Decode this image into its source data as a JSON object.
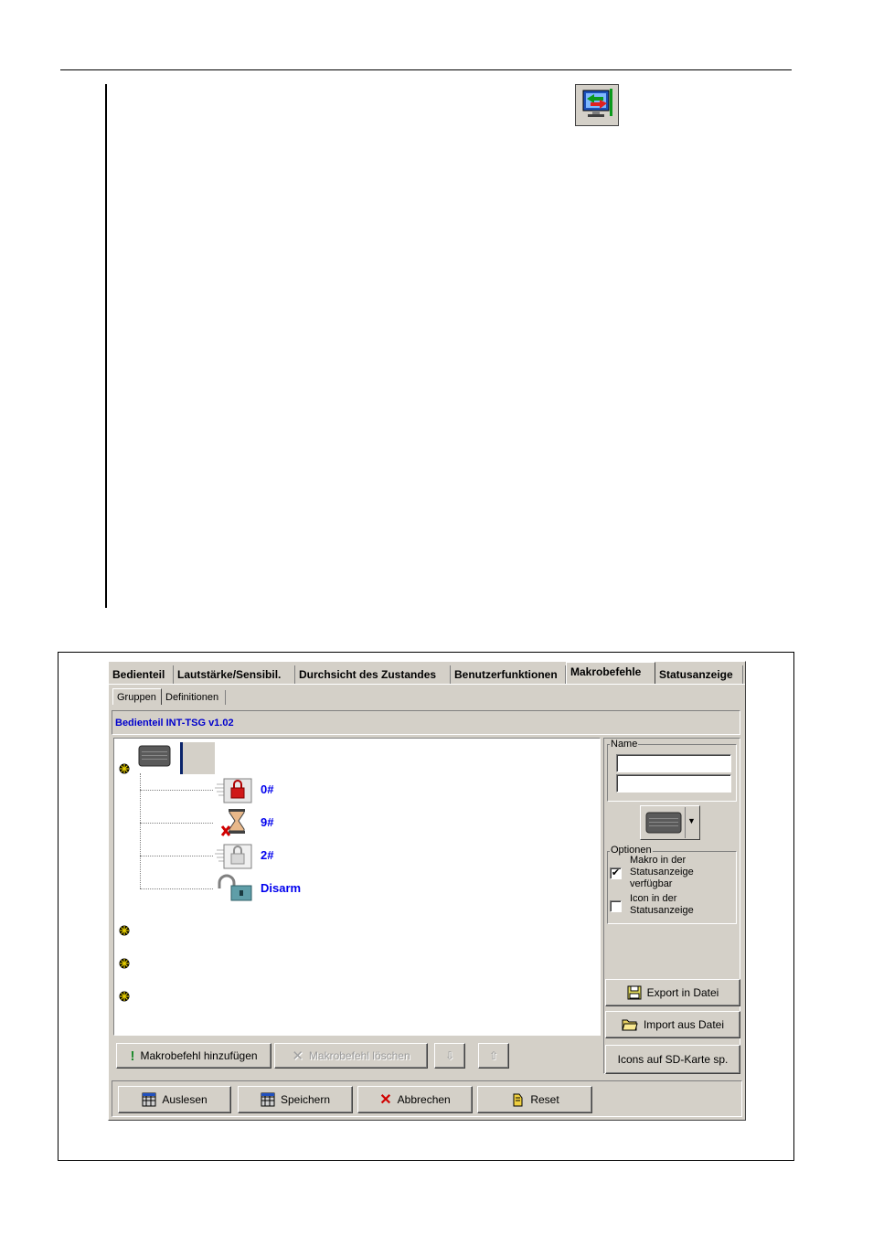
{
  "tabs": [
    {
      "label": "Bedienteil"
    },
    {
      "label": "Lautstärke/Sensibil."
    },
    {
      "label": "Durchsicht des Zustandes"
    },
    {
      "label": "Benutzerfunktionen"
    },
    {
      "label": "Makrobefehle"
    },
    {
      "label": "Statusanzeige"
    }
  ],
  "subtabs": [
    {
      "label": "Gruppen"
    },
    {
      "label": "Definitionen"
    }
  ],
  "device_title": "Bedienteil INT-TSG v1.02",
  "macros": [
    {
      "label": "0#",
      "icon": "lock-icon"
    },
    {
      "label": "9#",
      "icon": "hourglass-cancel-icon"
    },
    {
      "label": "2#",
      "icon": "lock-gray-icon"
    },
    {
      "label": "Disarm",
      "icon": "unlock-icon"
    }
  ],
  "tree_buttons": {
    "add": "Makrobefehl hinzufügen",
    "delete": "Makrobefehl löschen"
  },
  "name_group": {
    "legend": "Name",
    "value1": "",
    "value2": ""
  },
  "options": {
    "legend": "Optionen",
    "opt1": {
      "label": "Makro in der Statusanzeige verfügbar",
      "checked": true
    },
    "opt2": {
      "label": "Icon in der Statusanzeige",
      "checked": false
    }
  },
  "side_buttons": {
    "export": "Export in Datei",
    "import": "Import aus Datei",
    "icons": "Icons auf SD-Karte sp."
  },
  "bottom_buttons": {
    "read": "Auslesen",
    "save": "Speichern",
    "cancel": "Abbrechen",
    "reset": "Reset"
  },
  "colors": {
    "window_bg": "#d4d0c8",
    "macro_text": "#0000ee",
    "title_text": "#0000cc"
  }
}
